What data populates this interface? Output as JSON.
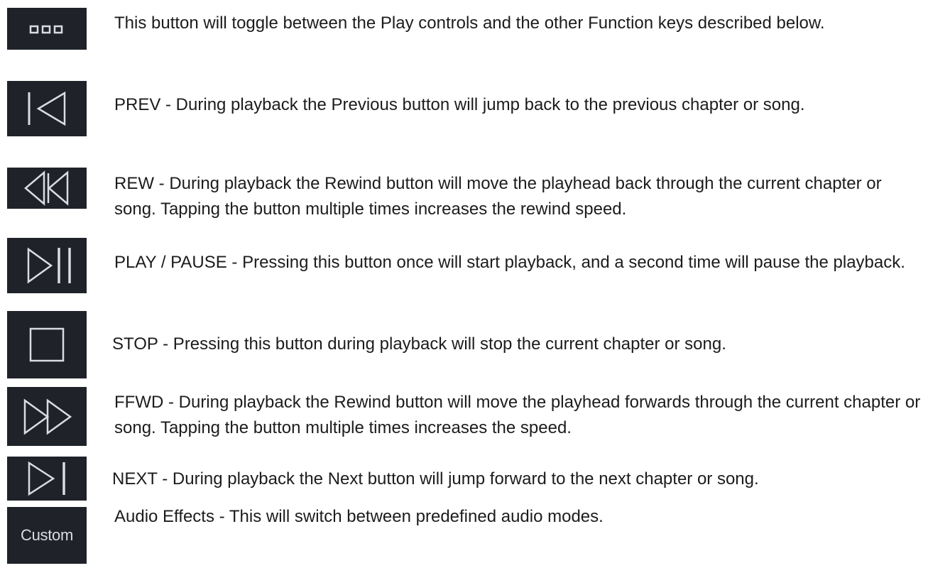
{
  "items": [
    {
      "icon": "more-dots-icon",
      "text": "This button will toggle between the Play controls and the other Function keys described below."
    },
    {
      "icon": "previous-track-icon",
      "text": "PREV - During playback the Previous button will jump back to the previous chapter or song."
    },
    {
      "icon": "rewind-icon",
      "text": "REW - During playback the Rewind button will move the playhead back through the current chapter or song. Tapping the button multiple times increases the rewind speed."
    },
    {
      "icon": "play-pause-icon",
      "text": "PLAY / PAUSE - Pressing this button once will start playback, and a second time will pause the playback."
    },
    {
      "icon": "stop-icon",
      "text": "STOP - Pressing this button during playback will stop the current chapter or song."
    },
    {
      "icon": "fast-forward-icon",
      "text": "FFWD - During playback the Rewind button will move the playhead forwards through the current chapter or song. Tapping the button multiple times increases the speed."
    },
    {
      "icon": "next-track-icon",
      "text": "NEXT - During playback the Next button will jump forward to the next chapter or song."
    },
    {
      "icon": "custom-audio-effects-icon",
      "icon_label": "Custom",
      "text": "Audio Effects - This will switch between predefined audio modes."
    }
  ],
  "colors": {
    "icon_background": "#1f2329",
    "icon_stroke": "#d9dde3",
    "text": "#1c1c1c"
  }
}
